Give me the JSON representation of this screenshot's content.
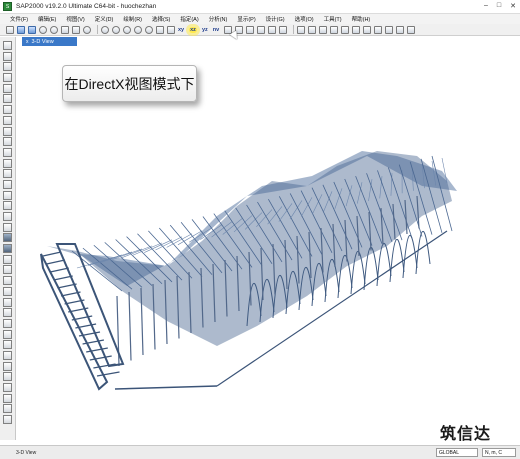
{
  "window": {
    "title": "SAP2000 v19.2.0 Ultimate C64-bit - huochezhan",
    "app_icon_label": "S",
    "controls": [
      "–",
      "□",
      "✕"
    ]
  },
  "menubar": {
    "items": [
      "文件(F)",
      "编辑(E)",
      "视图(V)",
      "定义(D)",
      "绘制(R)",
      "选择(S)",
      "指定(A)",
      "分析(N)",
      "显示(P)",
      "设计(G)",
      "选项(O)",
      "工具(T)",
      "帮助(H)"
    ]
  },
  "toolbar": {
    "view_buttons": [
      "xy",
      "xz",
      "yz",
      "nv"
    ],
    "selected_view": "xz"
  },
  "view_tab": {
    "label": "3-D View",
    "close_glyph": "x"
  },
  "callout": {
    "text": "在DirectX视图模式下"
  },
  "watermark": {
    "text": "筑信达"
  },
  "statusbar": {
    "left_text": "3-D View",
    "coord_system": "GLOBAL",
    "units": "N, m, C"
  },
  "colors": {
    "structure": "#4a6791",
    "view_tab": "#3a78c8",
    "highlight": "#ffe94d"
  },
  "icons": [
    "app-icon",
    "new-icon",
    "open-icon",
    "save-icon",
    "undo-icon",
    "redo-icon",
    "lock-icon",
    "run-icon",
    "zoom-icon",
    "pan-icon",
    "rotate-icon",
    "pointer-icon",
    "draw-frame-icon",
    "draw-area-icon",
    "select-all-icon"
  ]
}
